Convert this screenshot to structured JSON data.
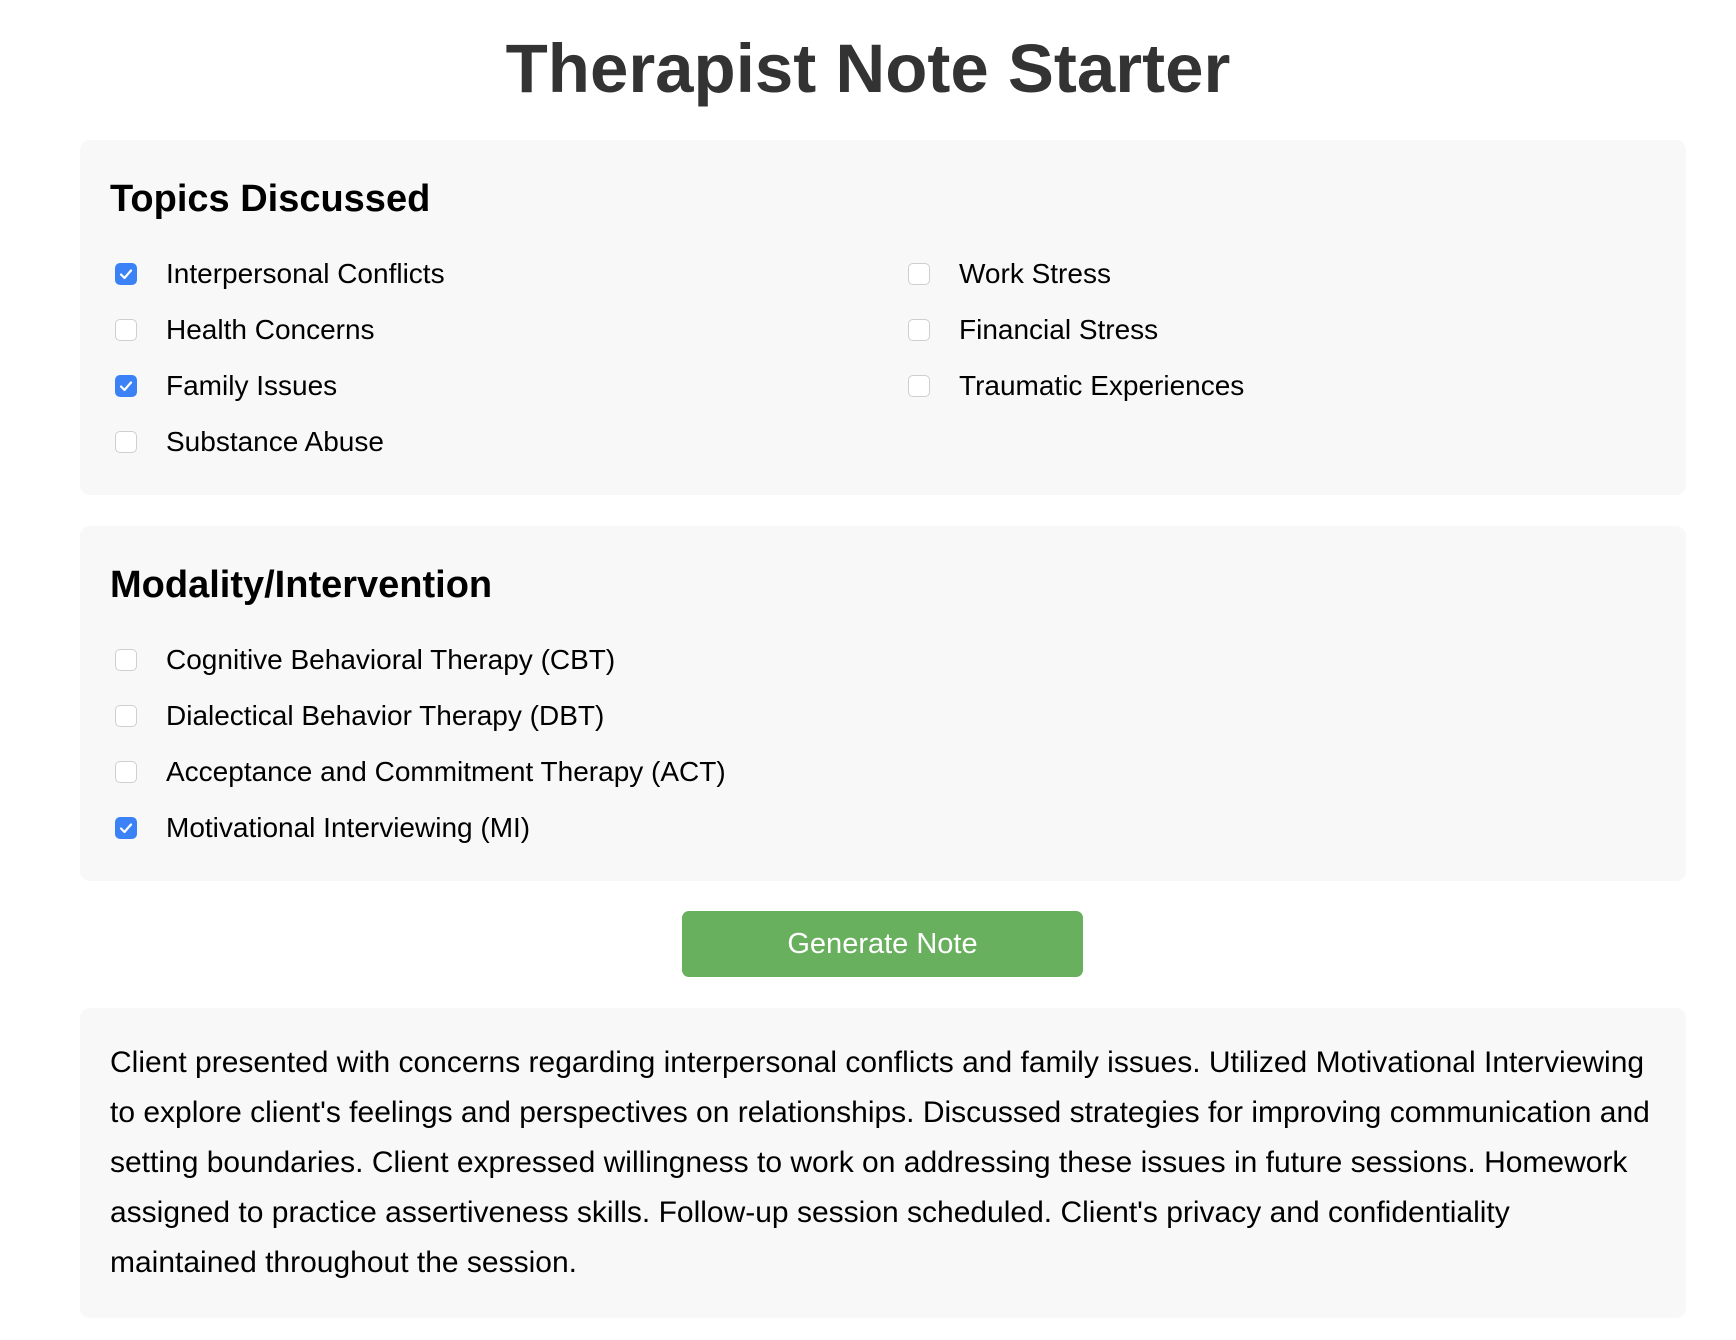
{
  "title": "Therapist Note Starter",
  "topics": {
    "heading": "Topics Discussed",
    "items": [
      {
        "label": "Interpersonal Conflicts",
        "checked": true
      },
      {
        "label": "Work Stress",
        "checked": false
      },
      {
        "label": "Health Concerns",
        "checked": false
      },
      {
        "label": "Financial Stress",
        "checked": false
      },
      {
        "label": "Family Issues",
        "checked": true
      },
      {
        "label": "Traumatic Experiences",
        "checked": false
      },
      {
        "label": "Substance Abuse",
        "checked": false
      }
    ]
  },
  "modality": {
    "heading": "Modality/Intervention",
    "items": [
      {
        "label": "Cognitive Behavioral Therapy (CBT)",
        "checked": false
      },
      {
        "label": "Dialectical Behavior Therapy (DBT)",
        "checked": false
      },
      {
        "label": "Acceptance and Commitment Therapy (ACT)",
        "checked": false
      },
      {
        "label": "Motivational Interviewing (MI)",
        "checked": true
      }
    ]
  },
  "actions": {
    "generate_label": "Generate Note"
  },
  "note": {
    "text": "Client presented with concerns regarding interpersonal conflicts and family issues. Utilized Motivational Interviewing to explore client's feelings and perspectives on relationships. Discussed strategies for improving communication and setting boundaries. Client expressed willingness to work on addressing these issues in future sessions. Homework assigned to practice assertiveness skills. Follow-up session scheduled. Client's privacy and confidentiality maintained throughout the session."
  },
  "colors": {
    "checkbox_checked": "#3b82f6",
    "button_bg": "#69b05e",
    "panel_bg": "#f8f8f8",
    "title_text": "#333333"
  }
}
